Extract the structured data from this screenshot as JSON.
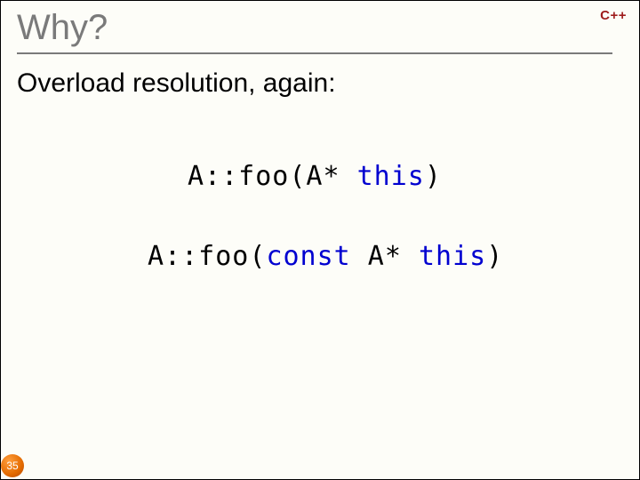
{
  "title": "Why?",
  "logo": "C++",
  "subtitle": "Overload resolution, again:",
  "code": {
    "line1": {
      "prefix": "A::foo(A* ",
      "this": "this",
      "suffix": ")"
    },
    "line2": {
      "prefix": "A::foo(",
      "const": "const",
      "mid": " A* ",
      "this": "this",
      "suffix": ")"
    }
  },
  "page_number": "35"
}
